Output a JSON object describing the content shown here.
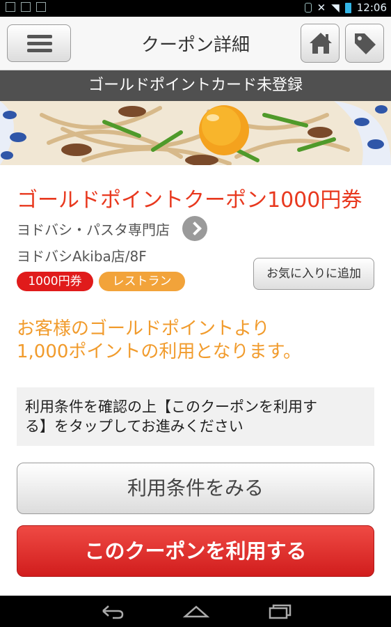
{
  "status_bar": {
    "time": "12:06"
  },
  "nav": {
    "title": "クーポン詳細"
  },
  "banner": {
    "text": "ゴールドポイントカード未登録"
  },
  "coupon": {
    "title": "ゴールドポイントクーポン1000円券",
    "store_name": "ヨドバシ・パスタ専門店",
    "location": "ヨドバシAkiba店/8F",
    "tags": {
      "price": "1000円券",
      "category": "レストラン"
    },
    "favorite_label": "お気に入りに追加",
    "points_line1": "お客様のゴールドポイントより",
    "points_line2": "1,000ポイントの利用となります。",
    "notice_line1": "利用条件を確認の上【このクーポンを利用す",
    "notice_line2": "る】をタップしてお進みください"
  },
  "buttons": {
    "terms": "利用条件をみる",
    "use": "このクーポンを利用する"
  },
  "icons": [
    "menu-icon",
    "home-icon",
    "tag-icon",
    "chevron-right-icon",
    "back-icon",
    "home-nav-icon",
    "recents-icon"
  ],
  "colors": {
    "accent_red": "#e8381e",
    "accent_orange": "#f19b2c",
    "banner": "#505050"
  }
}
